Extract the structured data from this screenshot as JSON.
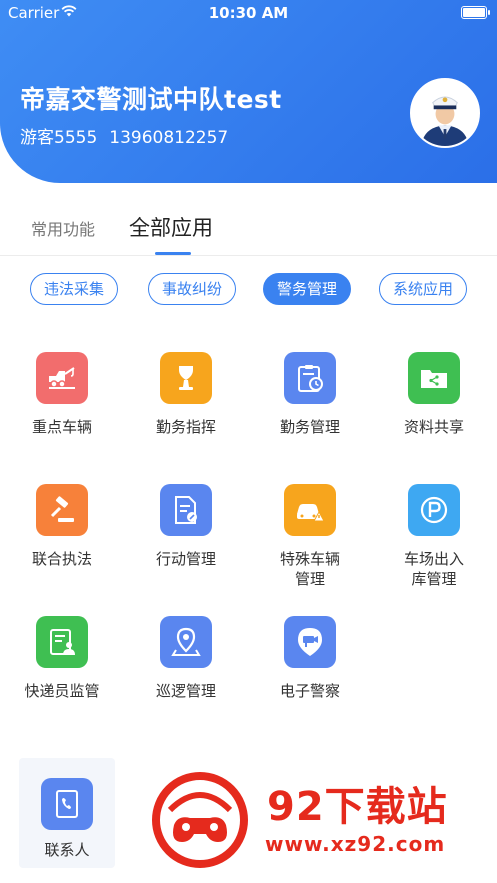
{
  "status_bar": {
    "carrier": "Carrier",
    "time": "10:30 AM"
  },
  "header": {
    "org_title": "帝嘉交警测试中队test",
    "user_name": "游客5555",
    "phone": "13960812257",
    "accent_color": "#2f77ee"
  },
  "tabs": [
    {
      "label": "常用功能",
      "active": false
    },
    {
      "label": "全部应用",
      "active": true
    }
  ],
  "chips": [
    {
      "label": "违法采集",
      "active": false
    },
    {
      "label": "事故纠纷",
      "active": false
    },
    {
      "label": "警务管理",
      "active": true
    },
    {
      "label": "系统应用",
      "active": false
    }
  ],
  "apps": [
    {
      "label": "重点车辆",
      "icon": "tow-truck-icon",
      "color": "#f26d6d"
    },
    {
      "label": "勤务指挥",
      "icon": "trophy-icon",
      "color": "#f7a51d"
    },
    {
      "label": "勤务管理",
      "icon": "clipboard-clock-icon",
      "color": "#5a86ef"
    },
    {
      "label": "资料共享",
      "icon": "shared-folder-icon",
      "color": "#3fbf52"
    },
    {
      "label": "联合执法",
      "icon": "gavel-icon",
      "color": "#f7813a"
    },
    {
      "label": "行动管理",
      "icon": "document-edit-icon",
      "color": "#5a86ef"
    },
    {
      "label": "特殊车辆管理",
      "icon": "car-warning-icon",
      "color": "#f7a51d"
    },
    {
      "label": "车场出入库管理",
      "icon": "parking-icon",
      "color": "#3ea8f2"
    },
    {
      "label": "快递员监管",
      "icon": "courier-doc-icon",
      "color": "#3fbf52"
    },
    {
      "label": "巡逻管理",
      "icon": "map-pin-icon",
      "color": "#5a86ef"
    },
    {
      "label": "电子警察",
      "icon": "camera-pin-icon",
      "color": "#5a86ef"
    }
  ],
  "contact": {
    "label": "联系人",
    "icon": "phone-book-icon",
    "color": "#5a86ef"
  },
  "watermark": {
    "brand": "92下载站",
    "url": "www.xz92.com",
    "color": "#e52a1d"
  }
}
